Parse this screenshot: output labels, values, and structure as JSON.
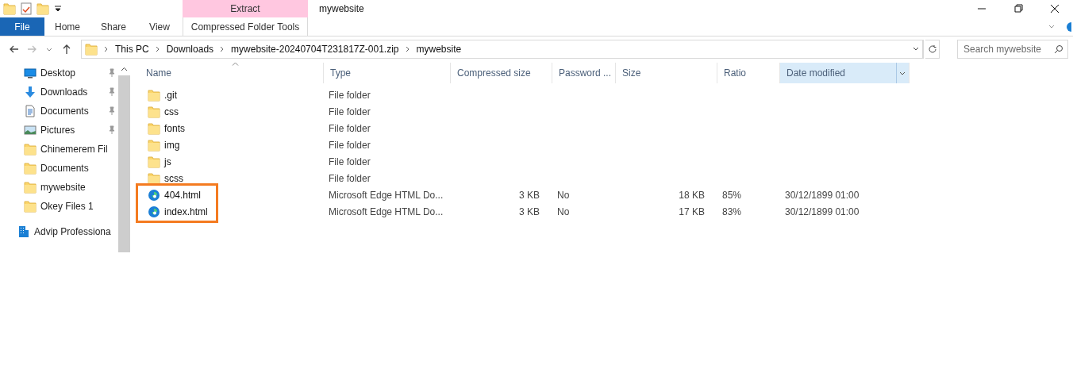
{
  "window": {
    "title": "mywebsite"
  },
  "ribbon": {
    "context_group": "Extract",
    "tabs": [
      {
        "label": "File",
        "kind": "file"
      },
      {
        "label": "Home",
        "kind": "tab"
      },
      {
        "label": "Share",
        "kind": "tab"
      },
      {
        "label": "View",
        "kind": "tab"
      },
      {
        "label": "Compressed Folder Tools",
        "kind": "context"
      }
    ]
  },
  "breadcrumb": [
    "This PC",
    "Downloads",
    "mywebsite-20240704T231817Z-001.zip",
    "mywebsite"
  ],
  "search": {
    "placeholder": "Search mywebsite"
  },
  "sidebar": {
    "items": [
      {
        "label": "Desktop",
        "kind": "desktop",
        "pinned": true
      },
      {
        "label": "Downloads",
        "kind": "download",
        "pinned": true
      },
      {
        "label": "Documents",
        "kind": "document",
        "pinned": true
      },
      {
        "label": "Pictures",
        "kind": "pictures",
        "pinned": true
      },
      {
        "label": "Chinemerem Fil",
        "kind": "folder",
        "pinned": false
      },
      {
        "label": "Documents",
        "kind": "folder",
        "pinned": false
      },
      {
        "label": "mywebsite",
        "kind": "folder",
        "pinned": false
      },
      {
        "label": "Okey Files 1",
        "kind": "folder",
        "pinned": false
      },
      {
        "label": "Advip Professiona",
        "kind": "building",
        "pinned": false
      }
    ]
  },
  "table": {
    "columns": [
      {
        "label": "Name",
        "sorted": true,
        "selected": false
      },
      {
        "label": "Type",
        "sorted": false,
        "selected": false
      },
      {
        "label": "Compressed size",
        "sorted": false,
        "selected": false
      },
      {
        "label": "Password ...",
        "sorted": false,
        "selected": false
      },
      {
        "label": "Size",
        "sorted": false,
        "selected": false
      },
      {
        "label": "Ratio",
        "sorted": false,
        "selected": false
      },
      {
        "label": "Date modified",
        "sorted": false,
        "selected": true
      }
    ],
    "rows": [
      {
        "kind": "folder",
        "highlighted": false,
        "cells": [
          ".git",
          "File folder"
        ]
      },
      {
        "kind": "folder",
        "highlighted": false,
        "cells": [
          "css",
          "File folder"
        ]
      },
      {
        "kind": "folder",
        "highlighted": false,
        "cells": [
          "fonts",
          "File folder"
        ]
      },
      {
        "kind": "folder",
        "highlighted": false,
        "cells": [
          "img",
          "File folder"
        ]
      },
      {
        "kind": "folder",
        "highlighted": false,
        "cells": [
          "js",
          "File folder"
        ]
      },
      {
        "kind": "folder",
        "highlighted": false,
        "cells": [
          "scss",
          "File folder"
        ]
      },
      {
        "kind": "edge",
        "highlighted": true,
        "cells": [
          "404.html",
          "Microsoft Edge HTML Do...",
          "3 KB",
          "No",
          "18 KB",
          "85%",
          "30/12/1899 01:00"
        ]
      },
      {
        "kind": "edge",
        "highlighted": true,
        "cells": [
          "index.html",
          "Microsoft Edge HTML Do...",
          "3 KB",
          "No",
          "17 KB",
          "83%",
          "30/12/1899 01:00"
        ]
      }
    ]
  },
  "highlight": {
    "color": "#f47b20"
  }
}
